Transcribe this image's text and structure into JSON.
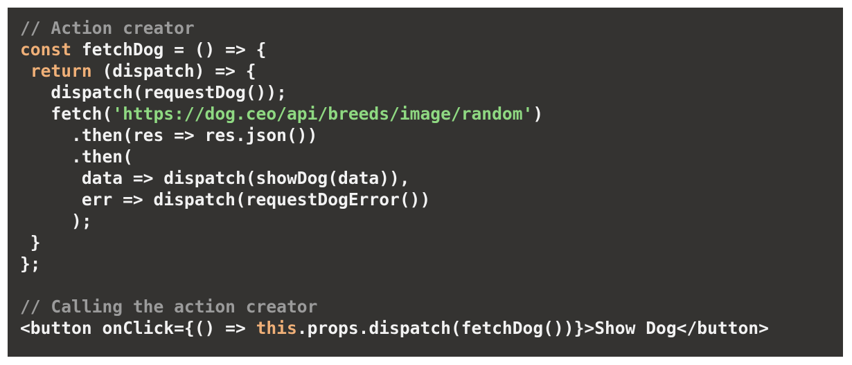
{
  "editor": {
    "language": "javascript",
    "background_color": "#343331",
    "page_background_color": "#ffffff",
    "token_colors": {
      "comment": "#9b9b9b",
      "keyword": "#f0b078",
      "string": "#8fd982",
      "plain": "#f2f2f2"
    },
    "lines": [
      {
        "index": 0,
        "text": "// Action creator",
        "tokens": [
          {
            "t": "// Action creator",
            "k": "comment"
          }
        ]
      },
      {
        "index": 1,
        "text": "const fetchDog = () => {",
        "tokens": [
          {
            "t": "const",
            "k": "keyword"
          },
          {
            "t": " fetchDog = () => {",
            "k": "plain"
          }
        ]
      },
      {
        "index": 2,
        "text": " return (dispatch) => {",
        "tokens": [
          {
            "t": " ",
            "k": "plain"
          },
          {
            "t": "return",
            "k": "keyword"
          },
          {
            "t": " (dispatch) => {",
            "k": "plain"
          }
        ]
      },
      {
        "index": 3,
        "text": "   dispatch(requestDog());",
        "tokens": [
          {
            "t": "   dispatch(requestDog());",
            "k": "plain"
          }
        ]
      },
      {
        "index": 4,
        "text": "   fetch('https://dog.ceo/api/breeds/image/random')",
        "tokens": [
          {
            "t": "   fetch(",
            "k": "plain"
          },
          {
            "t": "'https://dog.ceo/api/breeds/image/random'",
            "k": "string"
          },
          {
            "t": ")",
            "k": "plain"
          }
        ]
      },
      {
        "index": 5,
        "text": "     .then(res => res.json())",
        "tokens": [
          {
            "t": "     .then(res => res.json())",
            "k": "plain"
          }
        ]
      },
      {
        "index": 6,
        "text": "     .then(",
        "tokens": [
          {
            "t": "     .then(",
            "k": "plain"
          }
        ]
      },
      {
        "index": 7,
        "text": "      data => dispatch(showDog(data)),",
        "tokens": [
          {
            "t": "      data => dispatch(showDog(data)),",
            "k": "plain"
          }
        ]
      },
      {
        "index": 8,
        "text": "      err => dispatch(requestDogError())",
        "tokens": [
          {
            "t": "      err => dispatch(requestDogError())",
            "k": "plain"
          }
        ]
      },
      {
        "index": 9,
        "text": "     );",
        "tokens": [
          {
            "t": "     );",
            "k": "plain"
          }
        ]
      },
      {
        "index": 10,
        "text": " }",
        "tokens": [
          {
            "t": " }",
            "k": "plain"
          }
        ]
      },
      {
        "index": 11,
        "text": "};",
        "tokens": [
          {
            "t": "};",
            "k": "plain"
          }
        ]
      },
      {
        "index": 12,
        "text": "",
        "tokens": []
      },
      {
        "index": 13,
        "text": "// Calling the action creator",
        "tokens": [
          {
            "t": "// Calling the action creator",
            "k": "comment"
          }
        ]
      },
      {
        "index": 14,
        "text": "<button onClick={() => this.props.dispatch(fetchDog())}>Show Dog</button>",
        "tokens": [
          {
            "t": "<button onClick={() => ",
            "k": "plain"
          },
          {
            "t": "this",
            "k": "keyword"
          },
          {
            "t": ".props.dispatch(fetchDog())}>Show Dog</button>",
            "k": "plain"
          }
        ]
      }
    ]
  }
}
